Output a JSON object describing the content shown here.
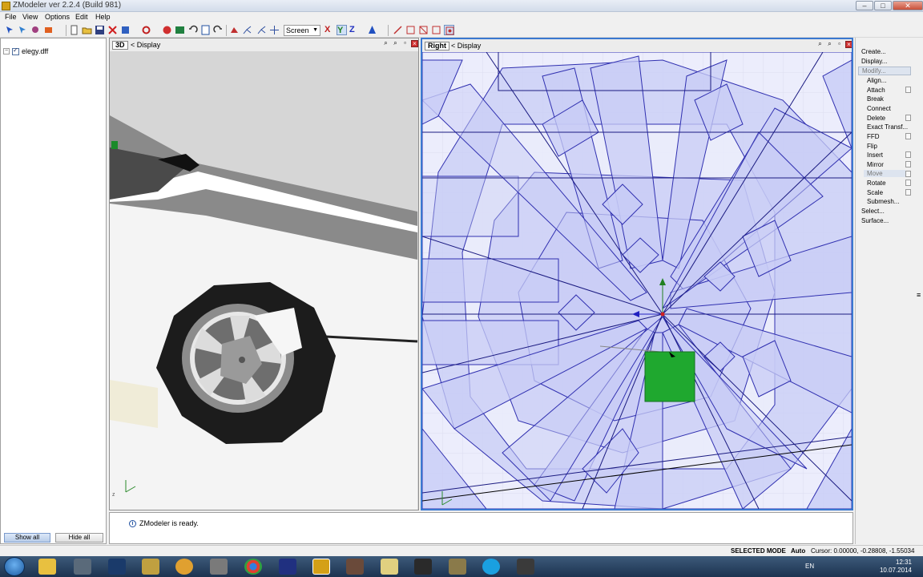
{
  "window": {
    "title": "ZModeler ver 2.2.4 (Build 981)",
    "controls": [
      "minimize-button",
      "maximize-button",
      "close-button"
    ]
  },
  "menu": [
    "File",
    "View",
    "Options",
    "Edit",
    "Help"
  ],
  "toolbar": {
    "screen_select_value": "Screen",
    "axis_labels": [
      "X",
      "Y",
      "Z"
    ]
  },
  "left_panel": {
    "tree_item_label": "elegy.dff",
    "show_all_label": "Show all",
    "hide_all_label": "Hide all"
  },
  "viewport_3d": {
    "label": "3D",
    "display_label": "Display"
  },
  "viewport_right": {
    "label": "Right",
    "display_label": "Display"
  },
  "right_panel": {
    "top_items": [
      "Create...",
      "Display...",
      "Modify..."
    ],
    "modify_items": [
      "Align...",
      "Attach",
      "Break",
      "Connect",
      "Delete",
      "Exact Transf...",
      "FFD",
      "Flip",
      "Insert",
      "Mirror",
      "Move",
      "Rotate",
      "Scale",
      "Submesh..."
    ],
    "bottom_items": [
      "Select...",
      "Surface..."
    ]
  },
  "log": {
    "message": "ZModeler is ready."
  },
  "statusbar": {
    "mode": "SELECTED MODE",
    "auto": "Auto",
    "cursor": "Cursor: 0.00000, -0.28808, -1.55034"
  },
  "taskbar": {
    "language": "EN",
    "time": "12:31",
    "date": "10.07.2014"
  },
  "colors": {
    "accent": "#3a78d0",
    "selection_green": "#1fa82f",
    "wire_fill": "#c8ccf6",
    "wire_line": "#3030b0"
  }
}
